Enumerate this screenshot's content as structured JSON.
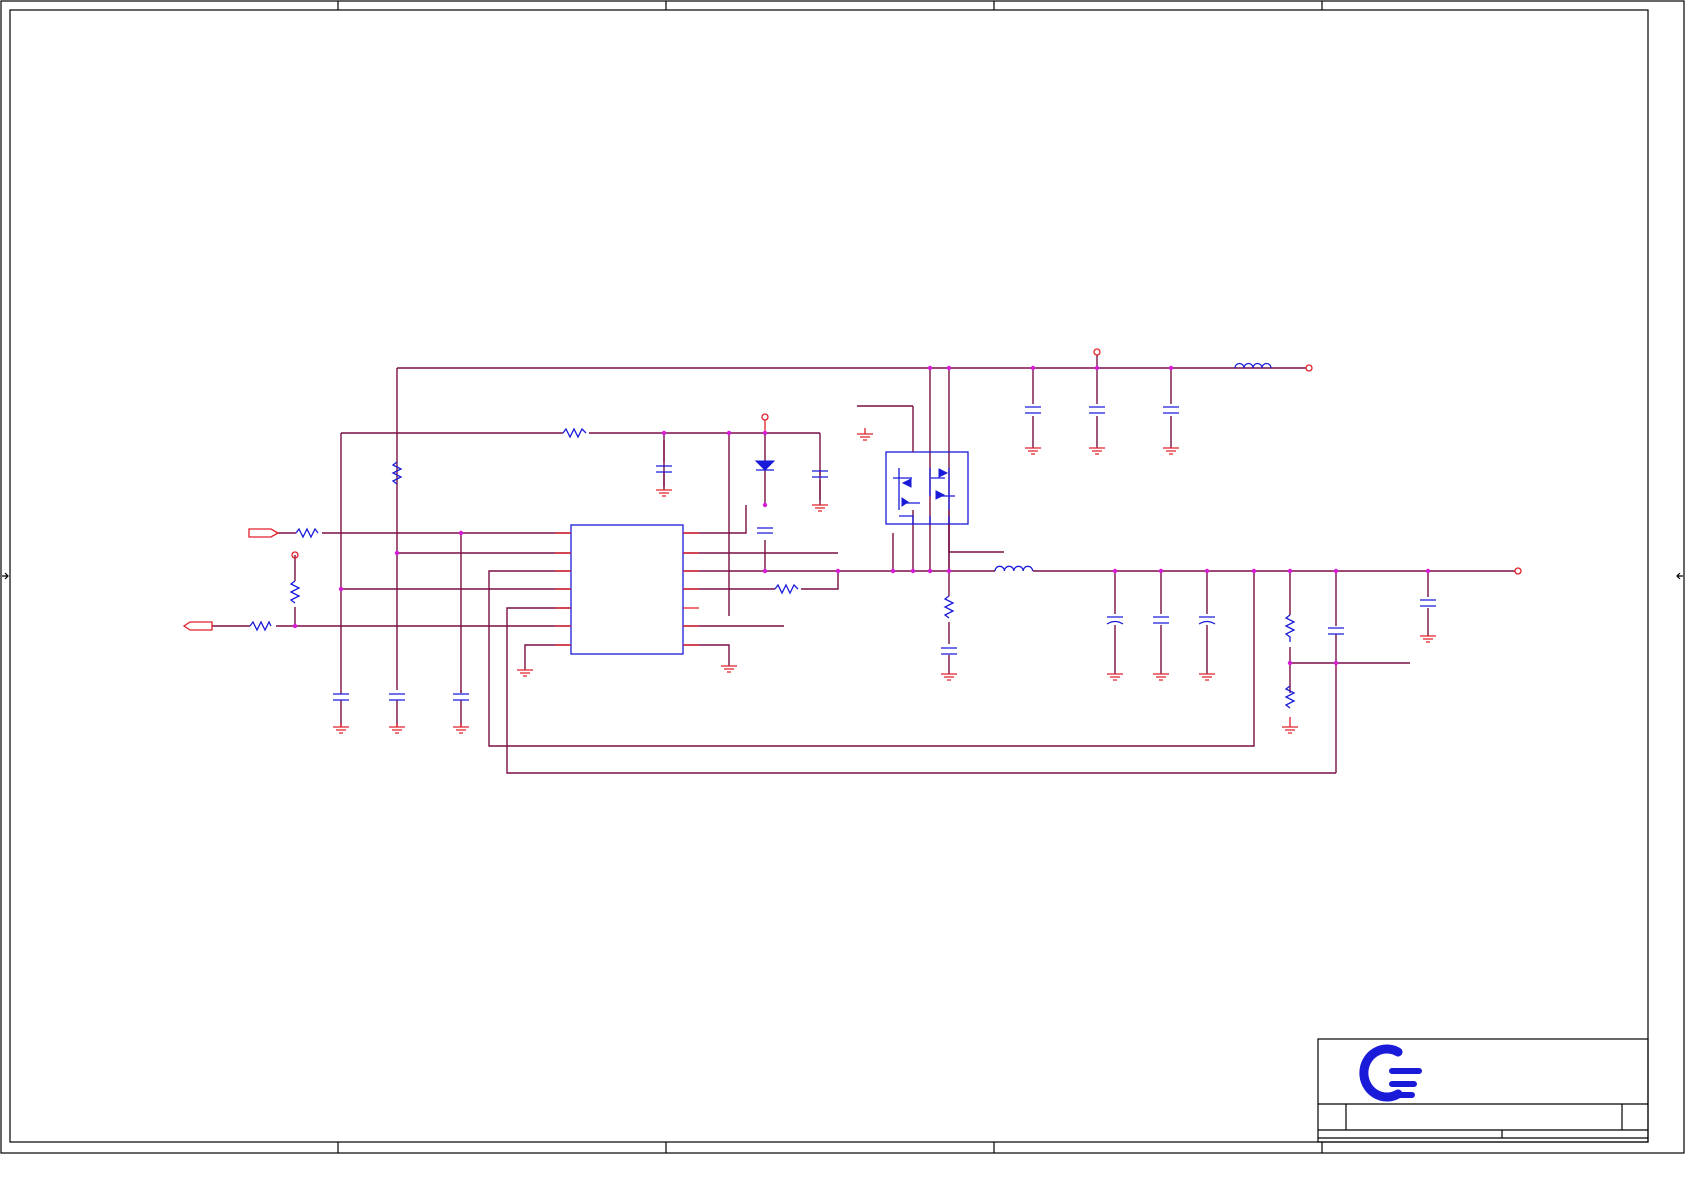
{
  "sheet": {
    "border_color": "#000000",
    "wire_color": "#7a0f45",
    "pin_color": "#e0202a",
    "symbol_color": "#1a1ad9",
    "junction_color": "#d81bd8"
  },
  "title_block": {
    "logo_icon": "c-lines-logo-icon",
    "logo_color": "#1a1ad9",
    "title": "",
    "sheet_number": ""
  }
}
